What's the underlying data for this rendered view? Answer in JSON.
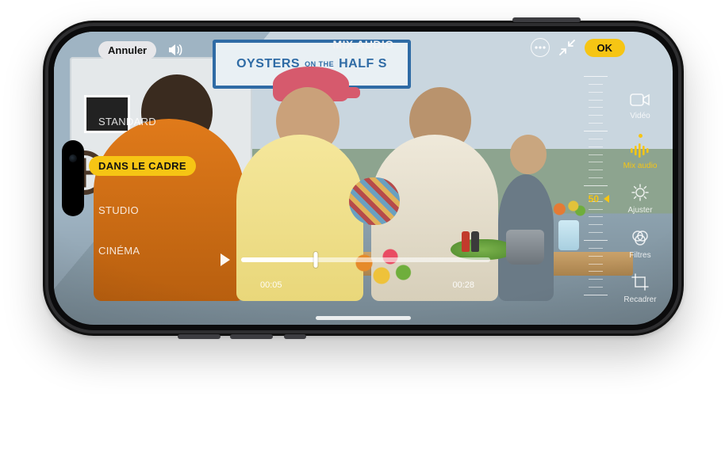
{
  "topbar": {
    "cancel_label": "Annuler",
    "title": "MIX AUDIO",
    "ok_label": "OK"
  },
  "scene": {
    "sign_text_left": "OYSTERS",
    "sign_text_mid": "ON THE",
    "sign_text_right": "HALF S"
  },
  "presets": {
    "items": [
      {
        "label": "STANDARD",
        "selected": false
      },
      {
        "label": "DANS LE CADRE",
        "selected": true
      },
      {
        "label": "STUDIO",
        "selected": false
      },
      {
        "label": "CINÉMA",
        "selected": false
      }
    ]
  },
  "tabs": {
    "items": [
      {
        "id": "video",
        "label": "Vidéo",
        "active": false
      },
      {
        "id": "mixaudio",
        "label": "Mix audio",
        "active": true
      },
      {
        "id": "adjust",
        "label": "Ajuster",
        "active": false
      },
      {
        "id": "filters",
        "label": "Filtres",
        "active": false
      },
      {
        "id": "crop",
        "label": "Recadrer",
        "active": false
      }
    ]
  },
  "ruler": {
    "value": "50"
  },
  "scrubber": {
    "current_time": "00:05",
    "total_time": "00:28",
    "progress_pct": 30
  },
  "colors": {
    "accent": "#f6c514"
  }
}
